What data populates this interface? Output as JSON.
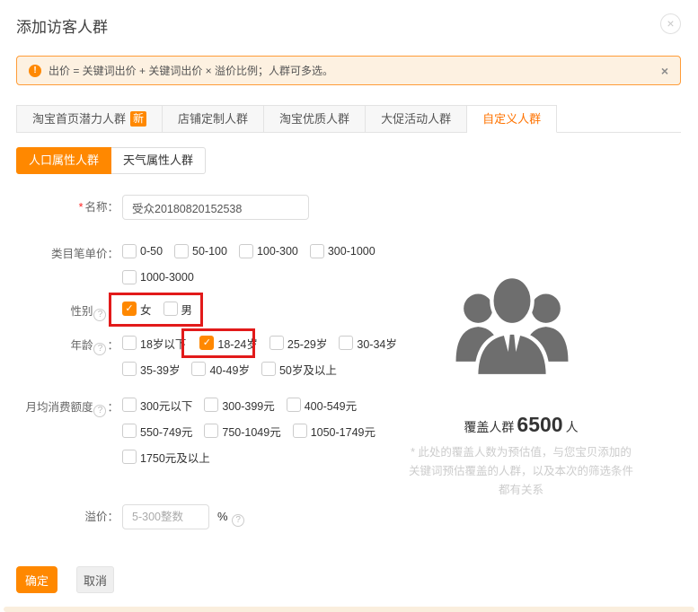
{
  "dialog": {
    "title": "添加访客人群"
  },
  "icons": {
    "close": "×",
    "alert": "!",
    "help": "?",
    "check": "✓"
  },
  "notice": {
    "text": "出价 = 关键词出价 + 关键词出价 × 溢价比例；人群可多选。"
  },
  "tabs": [
    {
      "label": "淘宝首页潜力人群",
      "badge": "新",
      "active": false
    },
    {
      "label": "店铺定制人群",
      "active": false
    },
    {
      "label": "淘宝优质人群",
      "active": false
    },
    {
      "label": "大促活动人群",
      "active": false
    },
    {
      "label": "自定义人群",
      "active": true
    }
  ],
  "subtabs": [
    {
      "label": "人口属性人群",
      "active": true
    },
    {
      "label": "天气属性人群",
      "active": false
    }
  ],
  "form": {
    "name": {
      "required": "*",
      "label": "名称",
      "colon": "：",
      "value": "受众20180820152538"
    },
    "category": {
      "label": "类目笔单价",
      "colon": "：",
      "opts": [
        "0-50",
        "50-100",
        "100-300",
        "300-1000",
        "1000-3000"
      ]
    },
    "gender": {
      "label": "性别",
      "colon": "：",
      "opts": [
        {
          "label": "女",
          "checked": true
        },
        {
          "label": "男",
          "checked": false
        }
      ]
    },
    "age": {
      "label": "年龄",
      "colon": "：",
      "opts": [
        {
          "label": "18岁以下",
          "checked": false
        },
        {
          "label": "18-24岁",
          "checked": true
        },
        {
          "label": "25-29岁",
          "checked": false
        },
        {
          "label": "30-34岁",
          "checked": false
        },
        {
          "label": "35-39岁",
          "checked": false
        },
        {
          "label": "40-49岁",
          "checked": false
        },
        {
          "label": "50岁及以上",
          "checked": false
        }
      ]
    },
    "spend": {
      "label": "月均消费额度",
      "colon": "：",
      "opts": [
        "300元以下",
        "300-399元",
        "400-549元",
        "550-749元",
        "750-1049元",
        "1050-1749元",
        "1750元及以上"
      ]
    },
    "premium": {
      "label": "溢价",
      "colon": "：",
      "placeholder": "5-300整数",
      "suffix": "%"
    }
  },
  "right_panel": {
    "coverage_prefix": "覆盖人群",
    "coverage_value": "6500",
    "coverage_unit": "人",
    "note_line1": "* 此处的覆盖人数为预估值，与您宝贝添加的",
    "note_line2": "关键词预估覆盖的人群，以及本次的筛选条件",
    "note_line3": "都有关系"
  },
  "footer": {
    "confirm": "确定",
    "cancel": "取消"
  },
  "colors": {
    "accent": "#ff8800",
    "active_tab_text": "#ff7300",
    "notice_bg": "#fdf1e1",
    "notice_border": "#ff9c38",
    "highlight_red": "#e21a1a",
    "people_icon_gray": "#6e6e6e"
  }
}
